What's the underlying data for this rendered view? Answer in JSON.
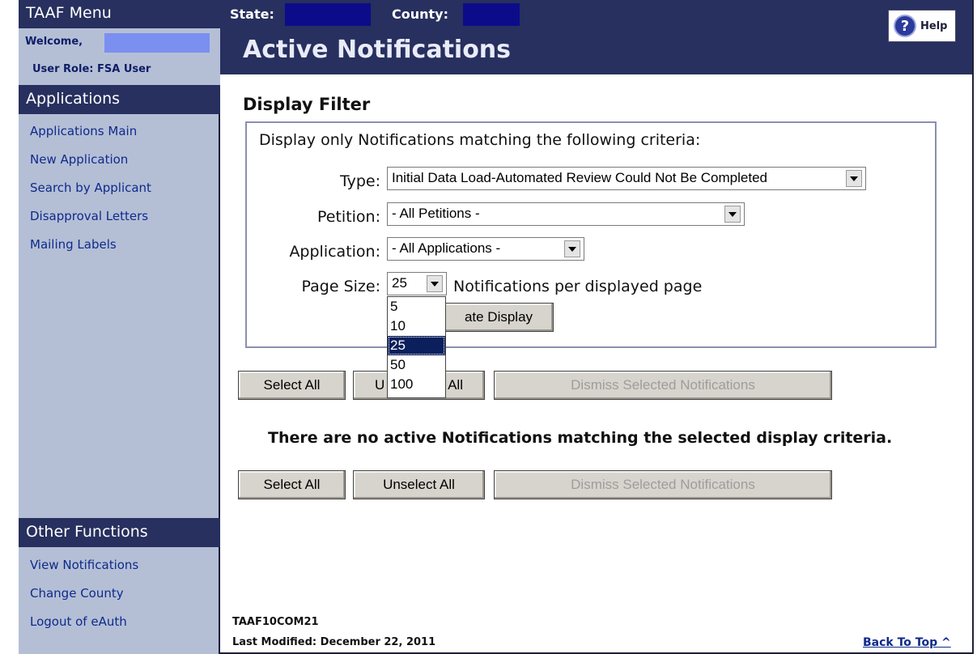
{
  "sidebar": {
    "menu_title": "TAAF Menu",
    "welcome_label": "Welcome,",
    "user_role": "User Role: FSA User",
    "applications_heading": "Applications",
    "applications_items": [
      {
        "label": "Applications Main"
      },
      {
        "label": "New Application"
      },
      {
        "label": "Search by Applicant"
      },
      {
        "label": "Disapproval Letters"
      },
      {
        "label": "Mailing Labels"
      }
    ],
    "other_heading": "Other Functions",
    "other_items": [
      {
        "label": "View Notifications"
      },
      {
        "label": "Change County"
      },
      {
        "label": "Logout of eAuth"
      }
    ]
  },
  "header": {
    "state_label": "State:",
    "county_label": "County:",
    "title": "Active Notifications",
    "help_label": "Help"
  },
  "filter": {
    "title": "Display Filter",
    "criteria_text": "Display only Notifications matching the following criteria:",
    "type_label": "Type:",
    "type_value": "Initial Data Load-Automated Review Could Not Be Completed",
    "petition_label": "Petition:",
    "petition_value": "- All Petitions -",
    "application_label": "Application:",
    "application_value": "- All Applications -",
    "page_size_label": "Page Size:",
    "page_size_value": "25",
    "page_size_suffix": "Notifications per displayed page",
    "page_size_options": [
      "5",
      "10",
      "25",
      "50",
      "100"
    ],
    "page_size_selected": "25",
    "update_button": "Update Display",
    "update_button_visible": "ate Display"
  },
  "actions": {
    "select_all": "Select All",
    "unselect_all": "Unselect All",
    "unselect_all_visible_left": "U",
    "unselect_all_visible_right": "All",
    "dismiss": "Dismiss Selected Notifications"
  },
  "message": "There are no active Notifications matching the selected display criteria.",
  "footer": {
    "page_id": "TAAF10COM21",
    "last_modified": "Last Modified: December 22, 2011",
    "back_to_top": "Back To Top ^"
  },
  "colors": {
    "nav_dark": "#27305e",
    "sidebar_bg": "#b4bfd6",
    "link": "#0f2a8a",
    "redacted": "#0c0c8a",
    "selection": "#0a1f5c"
  }
}
